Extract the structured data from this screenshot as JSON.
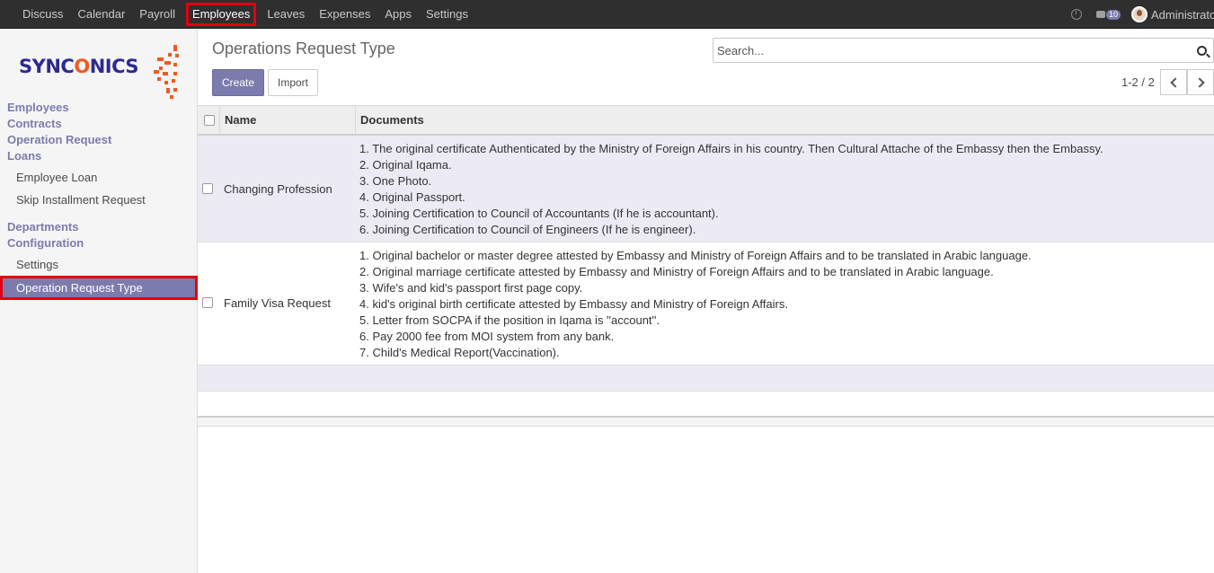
{
  "topnav": {
    "items": [
      "Discuss",
      "Calendar",
      "Payroll",
      "Employees",
      "Leaves",
      "Expenses",
      "Apps",
      "Settings"
    ],
    "active_index": 3,
    "chat_count": "10",
    "user": "Administrator"
  },
  "sidebar": {
    "logo_text_pre": "SYNC",
    "logo_text_o": "O",
    "logo_text_post": "NICS",
    "employees": "Employees",
    "contracts": "Contracts",
    "operation_request": "Operation Request",
    "loans": "Loans",
    "employee_loan": "Employee Loan",
    "skip_installment": "Skip Installment Request",
    "departments": "Departments",
    "configuration": "Configuration",
    "settings": "Settings",
    "operation_request_type": "Operation Request Type"
  },
  "main": {
    "title": "Operations Request Type",
    "create_label": "Create",
    "import_label": "Import",
    "search_placeholder": "Search...",
    "pager": "1-2 / 2"
  },
  "table": {
    "headers": {
      "name": "Name",
      "documents": "Documents"
    },
    "rows": [
      {
        "name": "Changing Profession",
        "docs": [
          "1. The original certificate Authenticated by the Ministry of Foreign Affairs in his country. Then Cultural Attache of the Embassy then the Embassy.",
          "2. Original Iqama.",
          "3. One Photo.",
          "4. Original Passport.",
          "5. Joining Certification to Council of Accountants (If he is accountant).",
          "6. Joining Certification to Council of Engineers (If he is engineer)."
        ]
      },
      {
        "name": "Family Visa Request",
        "docs": [
          "1. Original bachelor or master degree attested by Embassy and Ministry of Foreign Affairs and to be translated in Arabic language.",
          "2. Original marriage certificate attested by Embassy and Ministry of Foreign Affairs and to be translated in Arabic language.",
          "3. Wife's and kid's passport first page copy.",
          "4. kid's original birth certificate attested by Embassy and Ministry of Foreign Affairs.",
          "5. Letter from SOCPA if the position in Iqama is ''account''.",
          "6. Pay 2000 fee from MOI system from any bank.",
          "7. Child's Medical Report(Vaccination)."
        ]
      }
    ]
  },
  "colors": {
    "accent": "#7c7bad",
    "highlight": "#e3000f",
    "topbar": "#2f2f2f",
    "logo_blue": "#2e2a8f",
    "logo_orange": "#f05a23"
  }
}
